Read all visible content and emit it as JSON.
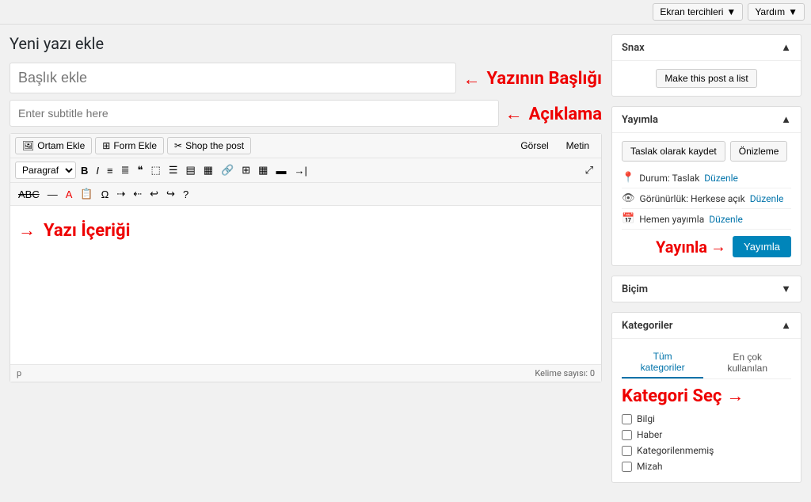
{
  "topbar": {
    "screen_options": "Ekran tercihleri",
    "help": "Yardım"
  },
  "page": {
    "title": "Yeni yazı ekle"
  },
  "title_input": {
    "placeholder": "Başlık ekle"
  },
  "title_annotation": {
    "arrow": "←",
    "text": "Yazının Başlığı"
  },
  "subtitle_input": {
    "placeholder": "Enter subtitle here"
  },
  "subtitle_annotation": {
    "arrow": "←",
    "text": "Açıklama"
  },
  "editor_toolbar": {
    "ortam_btn": "Ortam Ekle",
    "form_btn": "Form Ekle",
    "shop_btn": "Shop the post",
    "gorsel": "Görsel",
    "metin": "Metin"
  },
  "format_toolbar": {
    "paragraph": "Paragraf"
  },
  "content_annotation": {
    "arrow": "→",
    "text": "Yazı İçeriği"
  },
  "status_bar": {
    "p_label": "p",
    "word_count": "Kelime sayısı: 0"
  },
  "snax_panel": {
    "title": "Snax",
    "make_list_btn": "Make this post a list"
  },
  "publish_panel": {
    "title": "Yayımla",
    "save_btn": "Taslak olarak kaydet",
    "preview_btn": "Önizleme",
    "status_label": "Durum: Taslak",
    "status_link": "Düzenle",
    "visibility_label": "Görünürlük: Herkese açık",
    "visibility_link": "Düzenle",
    "schedule_label": "Hemen yayımla",
    "schedule_link": "Düzenle"
  },
  "yayinla_annotation": {
    "text": "Yayınla",
    "arrow": "→"
  },
  "yayimla_btn": "Yayımla",
  "bicim_panel": {
    "title": "Biçim"
  },
  "kategoriler_panel": {
    "title": "Kategoriler",
    "tab_all": "Tüm kategoriler",
    "tab_popular": "En çok kullanılan",
    "items": [
      {
        "label": "Bilgi"
      },
      {
        "label": "Haber"
      },
      {
        "label": "Kategorilenmemiş"
      },
      {
        "label": "Mizah"
      }
    ]
  },
  "kategori_annotation": {
    "text": "Kategori Seç",
    "arrow": "→"
  }
}
